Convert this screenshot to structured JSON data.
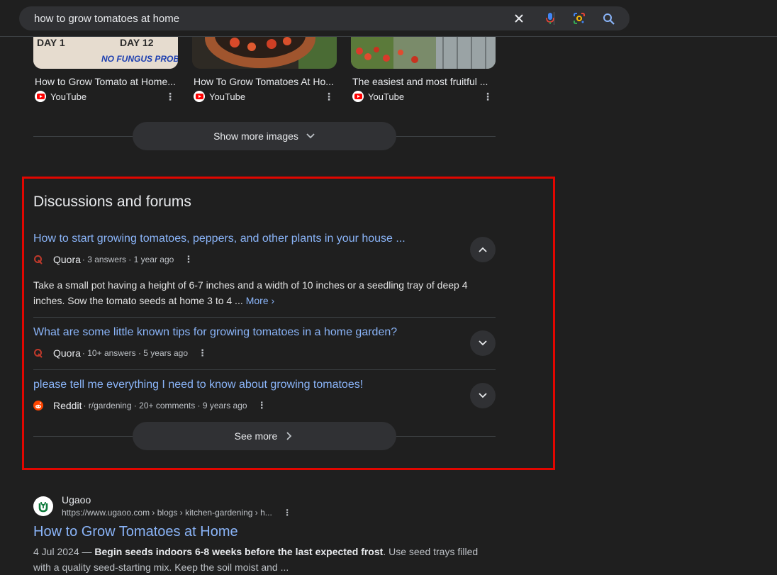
{
  "search": {
    "query": "how to grow tomatoes at home"
  },
  "videos": [
    {
      "title": "How to Grow Tomato at Home...",
      "source": "YouTube",
      "thumb_text_left": "DAY 1",
      "thumb_text_right": "DAY 12",
      "thumb_caption": "NO FUNGUS PROBLEM"
    },
    {
      "title": "How To Grow Tomatoes At Ho...",
      "source": "YouTube"
    },
    {
      "title": "The easiest and most fruitful ...",
      "source": "YouTube"
    }
  ],
  "show_more_images": "Show more images",
  "discussions": {
    "title": "Discussions and forums",
    "items": [
      {
        "title": "How to start growing tomatoes, peppers, and other plants in your house ...",
        "source": "Quora",
        "meta": "· 3 answers · 1 year ago",
        "expanded": true,
        "snippet": "Take a small pot having a height of 6-7 inches and a width of 10 inches or a seedling tray of deep 4 inches. Sow the tomato seeds at home 3 to 4 ...",
        "more": "More"
      },
      {
        "title": "What are some little known tips for growing tomatoes in a home garden?",
        "source": "Quora",
        "meta": "· 10+ answers · 5 years ago",
        "expanded": false
      },
      {
        "title": "please tell me everything I need to know about growing tomatoes!",
        "source": "Reddit",
        "meta": "· r/gardening · 20+ comments · 9 years ago",
        "expanded": false
      }
    ],
    "see_more": "See more"
  },
  "result": {
    "site": "Ugaoo",
    "url": "https://www.ugaoo.com › blogs › kitchen-gardening › h...",
    "title": "How to Grow Tomatoes at Home",
    "date": "4 Jul 2024 — ",
    "bold": "Begin seeds indoors 6-8 weeks before the last expected frost",
    "rest": ". Use seed trays filled with a quality seed-starting mix. Keep the soil moist and ..."
  },
  "colors": {
    "link": "#8ab4f8",
    "highlight_box": "#e10600",
    "background": "#1f1f1f"
  }
}
